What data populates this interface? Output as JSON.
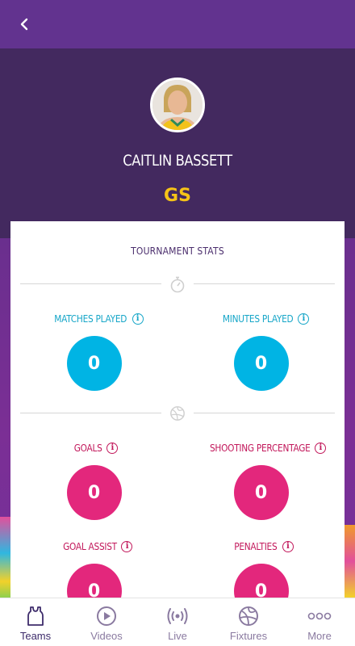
{
  "player": {
    "name": "CAITLIN BASSETT",
    "position": "GS"
  },
  "card": {
    "title": "TOURNAMENT STATS"
  },
  "stats": {
    "matches_played": {
      "label": "MATCHES PLAYED",
      "value": "0"
    },
    "minutes_played": {
      "label": "MINUTES PLAYED",
      "value": "0"
    },
    "goals": {
      "label": "GOALS",
      "value": "0"
    },
    "shooting_percentage": {
      "label": "SHOOTING PERCENTAGE",
      "value": "0"
    },
    "goal_assist": {
      "label": "GOAL ASSIST",
      "value": "0"
    },
    "penalties": {
      "label": "PENALTIES",
      "value": "0"
    }
  },
  "info_glyph": "i",
  "tabs": [
    {
      "label": "Teams",
      "icon": "jersey-icon",
      "active": true
    },
    {
      "label": "Videos",
      "icon": "play-circle-icon",
      "active": false
    },
    {
      "label": "Live",
      "icon": "broadcast-icon",
      "active": false
    },
    {
      "label": "Fixtures",
      "icon": "netball-icon",
      "active": false
    },
    {
      "label": "More",
      "icon": "more-dots-icon",
      "active": false
    }
  ],
  "colors": {
    "header": "#62338f",
    "hero": "#43295f",
    "accent_gold": "#f6c317",
    "teal": "#00b4e4",
    "pink": "#e3277c",
    "tab_active": "#3e2c6b",
    "tab_inactive": "#8a7aa0"
  }
}
